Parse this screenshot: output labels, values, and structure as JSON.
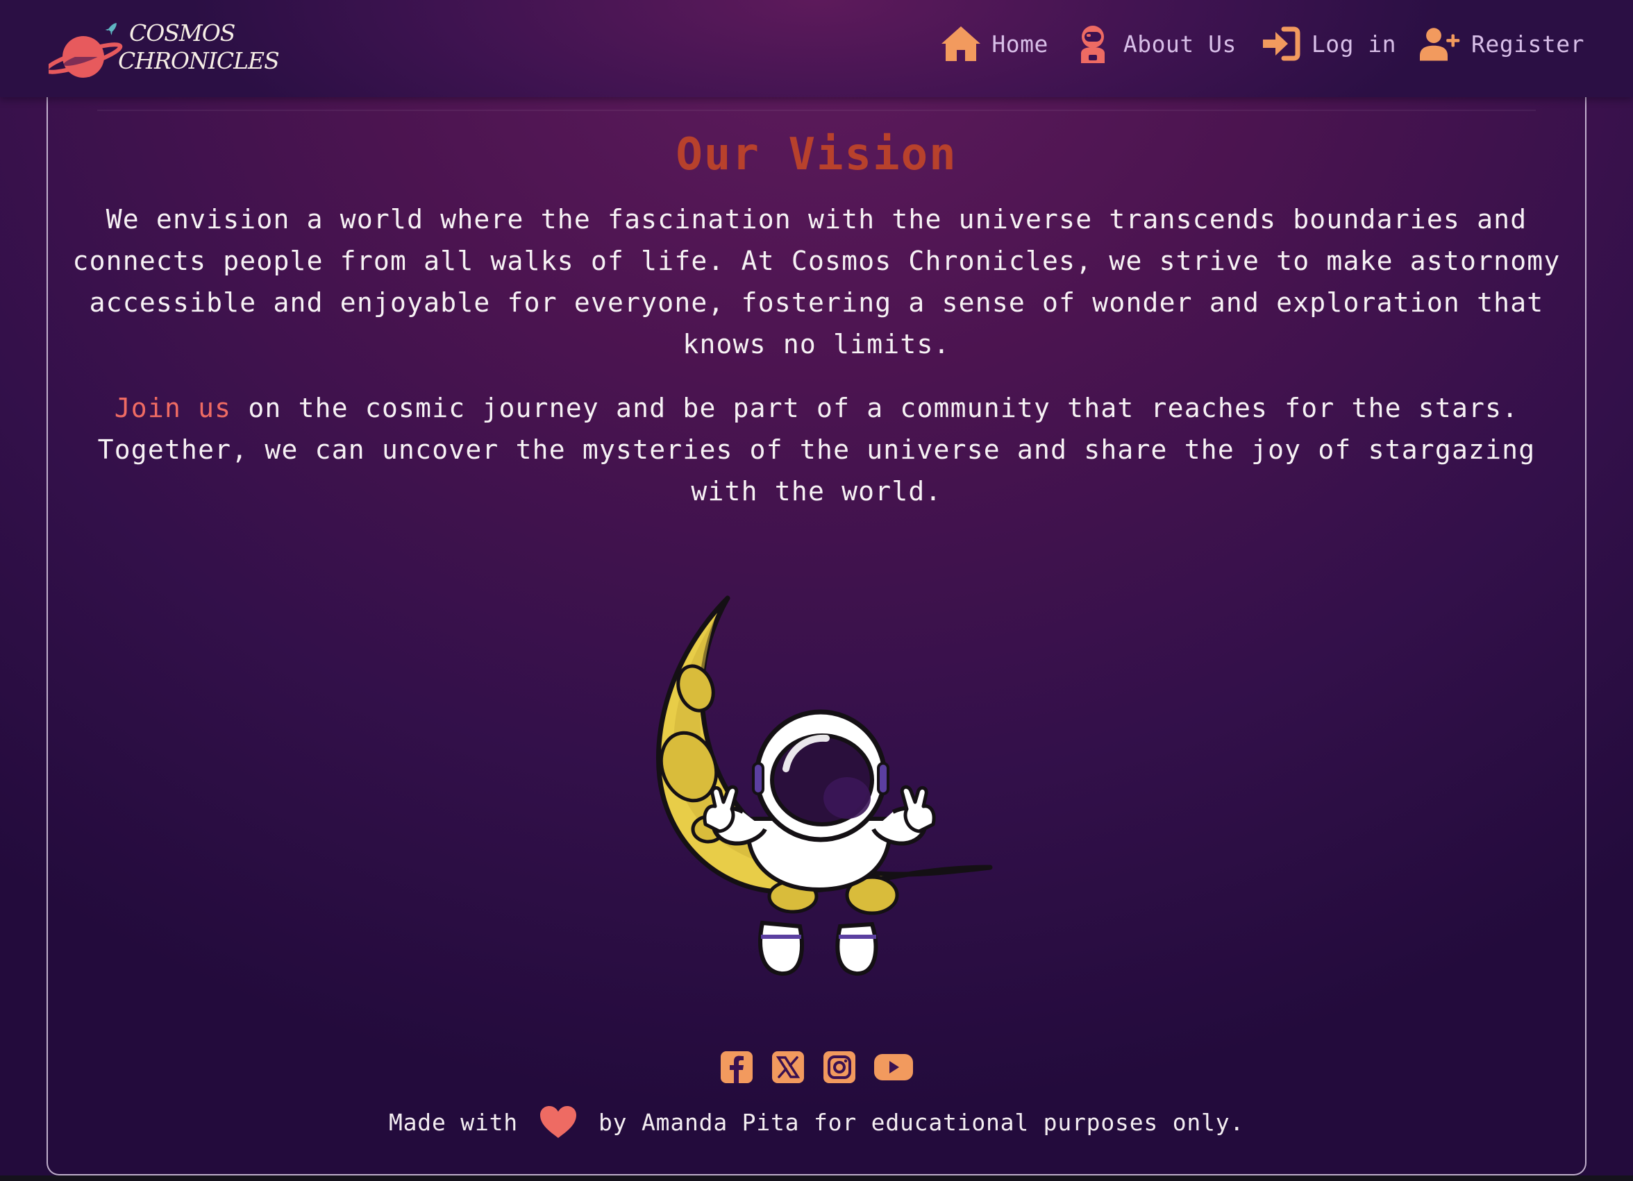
{
  "brand": {
    "line1": "Cosmos",
    "line2": "Chronicles",
    "logo_icon": "planet-rocket-logo"
  },
  "nav": {
    "items": [
      {
        "label": "Home",
        "icon": "house-icon"
      },
      {
        "label": "About Us",
        "icon": "astronaut-icon"
      },
      {
        "label": "Log in",
        "icon": "sign-in-icon"
      },
      {
        "label": "Register",
        "icon": "user-plus-icon"
      }
    ]
  },
  "main": {
    "title": "Our Vision",
    "paragraph1": "We envision a world where the fascination with the universe transcends boundaries and connects people from all walks of life. At Cosmos Chronicles, we strive to make astornomy accessible and enjoyable for everyone, fostering a sense of wonder and exploration that knows no limits.",
    "join_link": "Join us",
    "paragraph2_rest": " on the cosmic journey and be part of a community that reaches for the stars. Together, we can uncover the mysteries of the universe and share the joy of stargazing with the world.",
    "illustration": "astronaut-on-crescent-moon"
  },
  "footer": {
    "socials": [
      "facebook-icon",
      "x-twitter-icon",
      "instagram-icon",
      "youtube-icon"
    ],
    "made_with": "Made with",
    "credit": "by Amanda Pita for educational purposes only."
  },
  "colors": {
    "accent": "#f29a5e",
    "title": "#b8412c",
    "link": "#ef6b63",
    "nav_text": "#d8bfe8",
    "background": "#3a1150"
  }
}
